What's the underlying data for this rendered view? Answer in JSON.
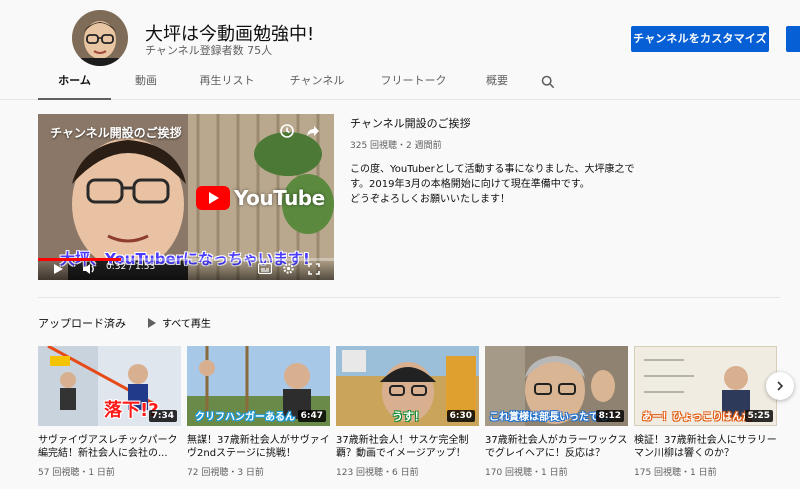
{
  "channel": {
    "name": "大坪は今動画勉強中!",
    "subscribers": "チャンネル登録者数 75人",
    "customize_label": "チャンネルをカスタマイズ"
  },
  "tabs": [
    {
      "label": "ホーム",
      "active": true
    },
    {
      "label": "動画"
    },
    {
      "label": "再生リスト"
    },
    {
      "label": "チャンネル"
    },
    {
      "label": "フリートーク"
    },
    {
      "label": "概要"
    }
  ],
  "featured": {
    "player_title": "チャンネル開設のご挨拶",
    "logo_text": "YouTube",
    "caption": "大坪、YouTuberになっちゃいます!",
    "time": "0:32 / 1:53",
    "progress": 0.28,
    "title": "チャンネル開設のご挨拶",
    "meta": "325 回視聴・2 週間前",
    "description": [
      "この度、YouTuberとして活動する事になりました、大坪康之で",
      "す。2019年3月の本格開始に向けて現在準備中です。",
      "どうぞよろしくお願いいたします！"
    ]
  },
  "uploads": {
    "section_title": "アップロード済み",
    "play_all": "すべて再生",
    "videos": [
      {
        "title": "サヴァイヴアスレチックパーク編完結！新社会人に会社の...",
        "meta": "57 回視聴・1 日前",
        "duration": "7:34",
        "caption": "落下!?"
      },
      {
        "title": "無謀！37歳新社会人がサヴァイヴ2ndステージに挑戦！",
        "meta": "72 回視聴・3 日前",
        "duration": "6:47",
        "caption": "クリフハンガーあるん"
      },
      {
        "title": "37歳新社会人！サスケ完全制覇？動画でイメージアップ！",
        "meta": "123 回視聴・6 日前",
        "duration": "6:30",
        "caption": "うす！"
      },
      {
        "title": "37歳新社会人がカラーワックスでグレイヘアに！反応は？",
        "meta": "170 回視聴・1 日前",
        "duration": "8:12",
        "caption": "これ賞様は部長いったでし"
      },
      {
        "title": "検証！37歳新社会人にサラリーマン川柳は響くのか？",
        "meta": "175 回視聴・1 日前",
        "duration": "5:25",
        "caption": "あー！ひょっこりはんだ"
      }
    ]
  },
  "colors": {
    "accent": "#065fd4",
    "youtube_red": "#ff0000"
  }
}
